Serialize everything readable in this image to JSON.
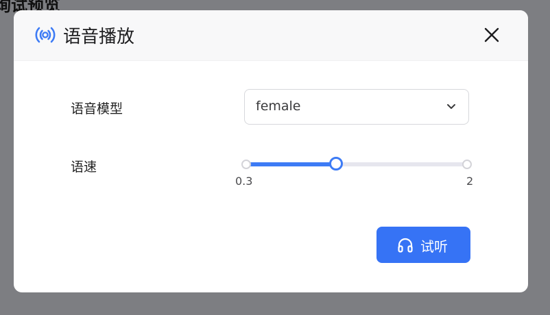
{
  "background": {
    "title_fragment": "询试预览"
  },
  "modal": {
    "title": "语音播放",
    "icon": "broadcast-icon",
    "accent_color": "#3d7bf5"
  },
  "form": {
    "voice_model": {
      "label": "语音模型",
      "value": "female"
    },
    "speed": {
      "label": "语速",
      "min_label": "0.3",
      "max_label": "2",
      "min": 0.3,
      "max": 2,
      "value": 0.99
    }
  },
  "actions": {
    "listen_label": "试听",
    "listen_icon": "headphones-icon",
    "button_color": "#3673f5"
  }
}
